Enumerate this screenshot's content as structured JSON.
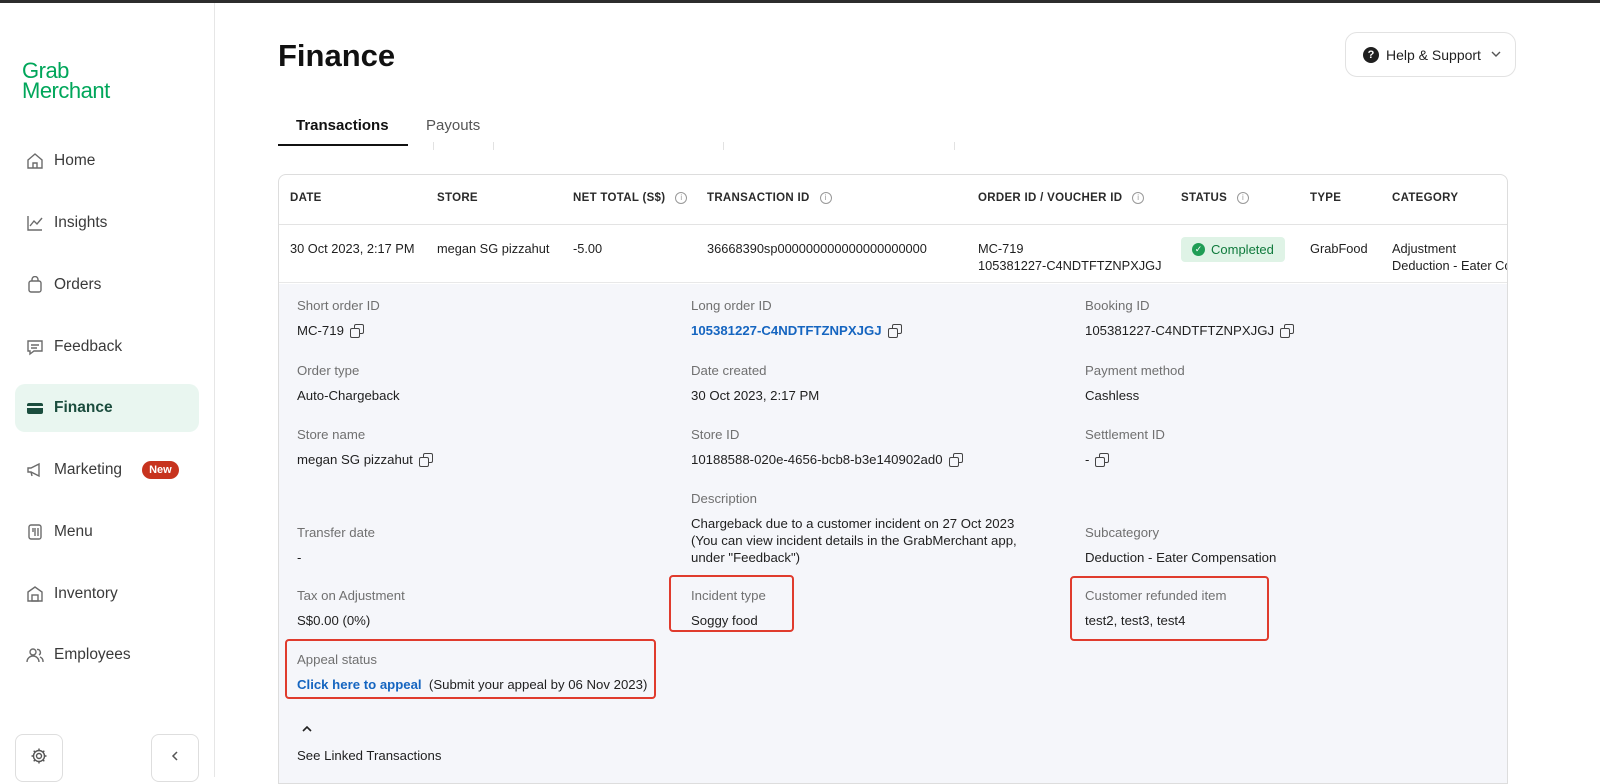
{
  "logo": {
    "line1": "Grab",
    "line2": "Merchant"
  },
  "sidebar": {
    "items": [
      {
        "label": "Home",
        "icon": "home-icon"
      },
      {
        "label": "Insights",
        "icon": "chart-icon"
      },
      {
        "label": "Orders",
        "icon": "bag-icon"
      },
      {
        "label": "Feedback",
        "icon": "chat-icon"
      },
      {
        "label": "Finance",
        "icon": "card-icon",
        "active": true
      },
      {
        "label": "Marketing",
        "icon": "megaphone-icon",
        "badge": "New"
      },
      {
        "label": "Menu",
        "icon": "menu-icon"
      },
      {
        "label": "Inventory",
        "icon": "store-icon"
      },
      {
        "label": "Employees",
        "icon": "people-icon"
      }
    ]
  },
  "header": {
    "title": "Finance",
    "help_label": "Help & Support"
  },
  "tabs": [
    {
      "label": "Transactions",
      "active": true
    },
    {
      "label": "Payouts"
    }
  ],
  "table": {
    "columns": [
      "DATE",
      "STORE",
      "NET TOTAL (S$)",
      "TRANSACTION ID",
      "ORDER ID / VOUCHER ID",
      "STATUS",
      "TYPE",
      "CATEGORY"
    ],
    "row": {
      "date": "30 Oct 2023, 2:17 PM",
      "store": "megan SG pizzahut",
      "net_total": "-5.00",
      "transaction_id": "36668390sp000000000000000000000",
      "order_id": "MC-719",
      "voucher_id": "105381227-C4NDTFTZNPXJGJ",
      "status": "Completed",
      "type": "GrabFood",
      "category_line1": "Adjustment",
      "category_line2": "Deduction - Eater Co"
    }
  },
  "details": {
    "short_order_id": {
      "label": "Short order ID",
      "value": "MC-719"
    },
    "long_order_id": {
      "label": "Long order ID",
      "value": "105381227-C4NDTFTZNPXJGJ"
    },
    "booking_id": {
      "label": "Booking ID",
      "value": "105381227-C4NDTFTZNPXJGJ"
    },
    "order_type": {
      "label": "Order type",
      "value": "Auto-Chargeback"
    },
    "date_created": {
      "label": "Date created",
      "value": "30 Oct 2023, 2:17 PM"
    },
    "payment_method": {
      "label": "Payment method",
      "value": "Cashless"
    },
    "store_name": {
      "label": "Store name",
      "value": "megan SG pizzahut"
    },
    "store_id": {
      "label": "Store ID",
      "value": "10188588-020e-4656-bcb8-b3e140902ad0"
    },
    "settlement_id": {
      "label": "Settlement ID",
      "value": "-"
    },
    "description": {
      "label": "Description",
      "value": "Chargeback due to a customer incident on 27 Oct 2023 (You can view incident details in the GrabMerchant app, under \"Feedback\")"
    },
    "transfer_date": {
      "label": "Transfer date",
      "value": "-"
    },
    "subcategory": {
      "label": "Subcategory",
      "value": "Deduction - Eater Compensation"
    },
    "tax": {
      "label": "Tax on Adjustment",
      "value": "S$0.00 (0%)"
    },
    "incident_type": {
      "label": "Incident type",
      "value": "Soggy food"
    },
    "refunded_item": {
      "label": "Customer refunded item",
      "value": "test2, test3, test4"
    },
    "appeal": {
      "label": "Appeal status",
      "link": "Click here to appeal",
      "note": "(Submit your appeal by 06 Nov 2023)"
    },
    "linked_label": "See Linked Transactions"
  },
  "colors": {
    "brand": "#00a65a",
    "active_bg": "#e9f6f0",
    "link": "#1565c0",
    "highlight": "#e03b2d",
    "badge": "#c7331e"
  }
}
